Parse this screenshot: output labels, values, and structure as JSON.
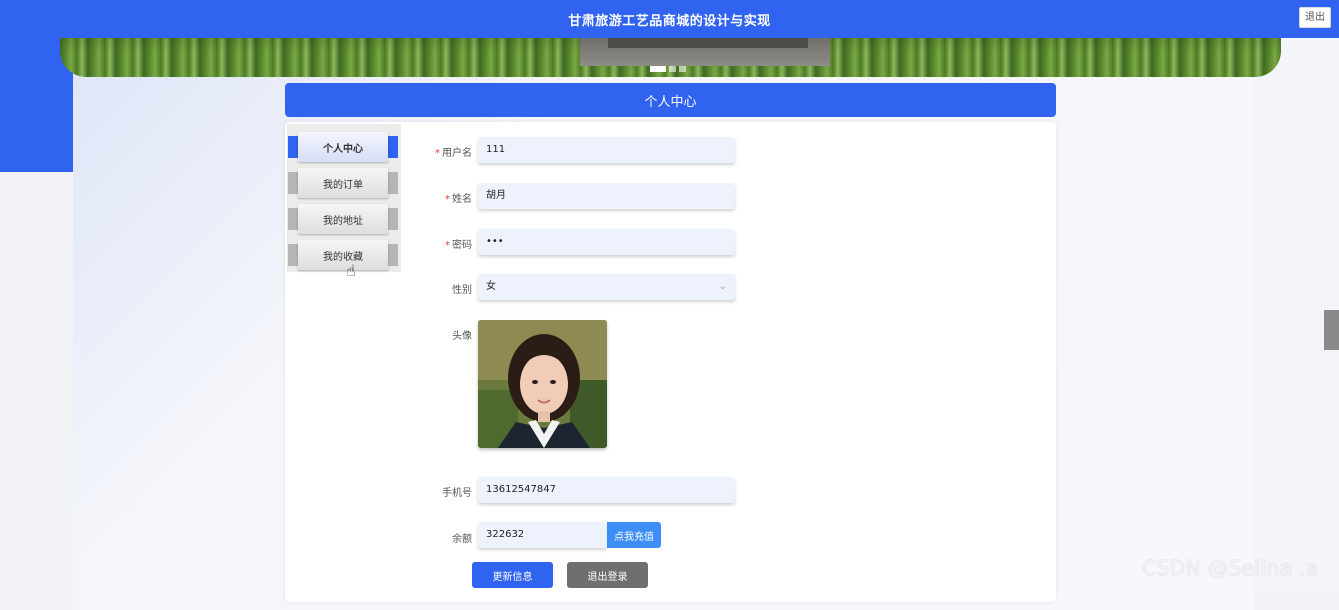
{
  "header": {
    "title": "甘肃旅游工艺品商城的设计与实现",
    "logout_label": "退出"
  },
  "banner": {
    "slide_count": 3,
    "active_slide": 1
  },
  "page": {
    "title": "个人中心"
  },
  "sidebar": {
    "items": [
      {
        "label": "个人中心",
        "active": true
      },
      {
        "label": "我的订单",
        "active": false
      },
      {
        "label": "我的地址",
        "active": false
      },
      {
        "label": "我的收藏",
        "active": false
      }
    ]
  },
  "form": {
    "username": {
      "label": "用户名",
      "required": "*",
      "value": "111"
    },
    "name": {
      "label": "姓名",
      "required": "*",
      "value": "胡月"
    },
    "password": {
      "label": "密码",
      "required": "*",
      "value": "•••"
    },
    "gender": {
      "label": "性别",
      "value": "女"
    },
    "avatar": {
      "label": "头像"
    },
    "phone": {
      "label": "手机号",
      "value": "13612547847"
    },
    "balance": {
      "label": "余额",
      "value": "322632",
      "recharge_label": "点我充值"
    }
  },
  "actions": {
    "update_label": "更新信息",
    "logout_label": "退出登录"
  },
  "watermark": "CSDN @Selina .a",
  "colors": {
    "primary": "#2f63f0",
    "recharge": "#3d8ff5",
    "logout": "#6f6f6f",
    "field_bg": "#eef2fc"
  }
}
